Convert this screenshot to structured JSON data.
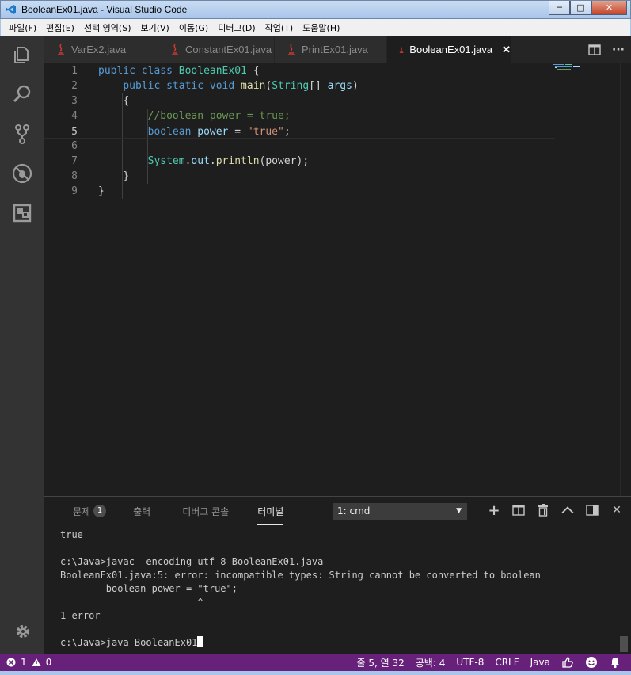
{
  "window": {
    "title": "BooleanEx01.java - Visual Studio Code",
    "minimize": "─",
    "maximize": "□",
    "close": "✕"
  },
  "menu": [
    "파일(F)",
    "편집(E)",
    "선택 영역(S)",
    "보기(V)",
    "이동(G)",
    "디버그(D)",
    "작업(T)",
    "도움말(H)"
  ],
  "activity": [
    "explorer-icon",
    "search-icon",
    "source-control-icon",
    "debug-icon",
    "extensions-icon",
    "settings-gear-icon"
  ],
  "tabs": [
    {
      "label": "VarEx2.java",
      "active": false
    },
    {
      "label": "ConstantEx01.java",
      "active": false
    },
    {
      "label": "PrintEx01.java",
      "active": false
    },
    {
      "label": "BooleanEx01.java",
      "active": true
    }
  ],
  "tab_close": "✕",
  "editor_actions": {
    "split": "split-editor-icon",
    "more": "···"
  },
  "code": {
    "l1": {
      "n": "1",
      "kw1": "public",
      "kw2": "class",
      "cls": "BooleanEx01",
      "rest": " {"
    },
    "l2": {
      "n": "2",
      "kw1": "public",
      "kw2": "static",
      "kw3": "void",
      "fn": "main",
      "p1": "(",
      "ty": "String",
      "p2": "[] ",
      "var": "args",
      "p3": ")"
    },
    "l3": {
      "n": "3",
      "txt": "{"
    },
    "l4": {
      "n": "4",
      "cm": "//boolean power = true;"
    },
    "l5": {
      "n": "5",
      "kw": "boolean",
      "var": "power",
      "eq": " = ",
      "str": "\"true\"",
      "end": ";"
    },
    "l6": {
      "n": "6"
    },
    "l7": {
      "n": "7",
      "cls": "System",
      "d1": ".",
      "out": "out",
      "d2": ".",
      "fn": "println",
      "args": "(power);"
    },
    "l8": {
      "n": "8",
      "txt": "}"
    },
    "l9": {
      "n": "9",
      "txt": "}"
    }
  },
  "panel": {
    "tabs": [
      {
        "label": "문제",
        "badge": "1"
      },
      {
        "label": "출력"
      },
      {
        "label": "디버그 콘솔"
      },
      {
        "label": "터미널",
        "active": true
      }
    ],
    "terminal_select": "1: cmd",
    "actions": {
      "add": "+",
      "split": "split-terminal-icon",
      "kill": "trash-icon",
      "maximize": "^",
      "layout": "panel-layout-icon",
      "close": "✕"
    }
  },
  "terminal": {
    "lines": [
      "true",
      "",
      "c:\\Java>javac -encoding utf-8 BooleanEx01.java",
      "BooleanEx01.java:5: error: incompatible types: String cannot be converted to boolean",
      "        boolean power = \"true\";",
      "                        ^",
      "1 error",
      ""
    ],
    "prompt": "c:\\Java>java BooleanEx01"
  },
  "status": {
    "errors": "1",
    "warnings": "0",
    "position": "줄 5, 열 32",
    "spaces": "공백: 4",
    "encoding": "UTF-8",
    "eol": "CRLF",
    "language": "Java"
  },
  "colors": {
    "statusbar": "#68217a",
    "keyword": "#569cd6",
    "type": "#4ec9b0",
    "function": "#dcdcaa",
    "variable": "#9cdcfe",
    "string": "#ce9178",
    "comment": "#6a9955"
  }
}
